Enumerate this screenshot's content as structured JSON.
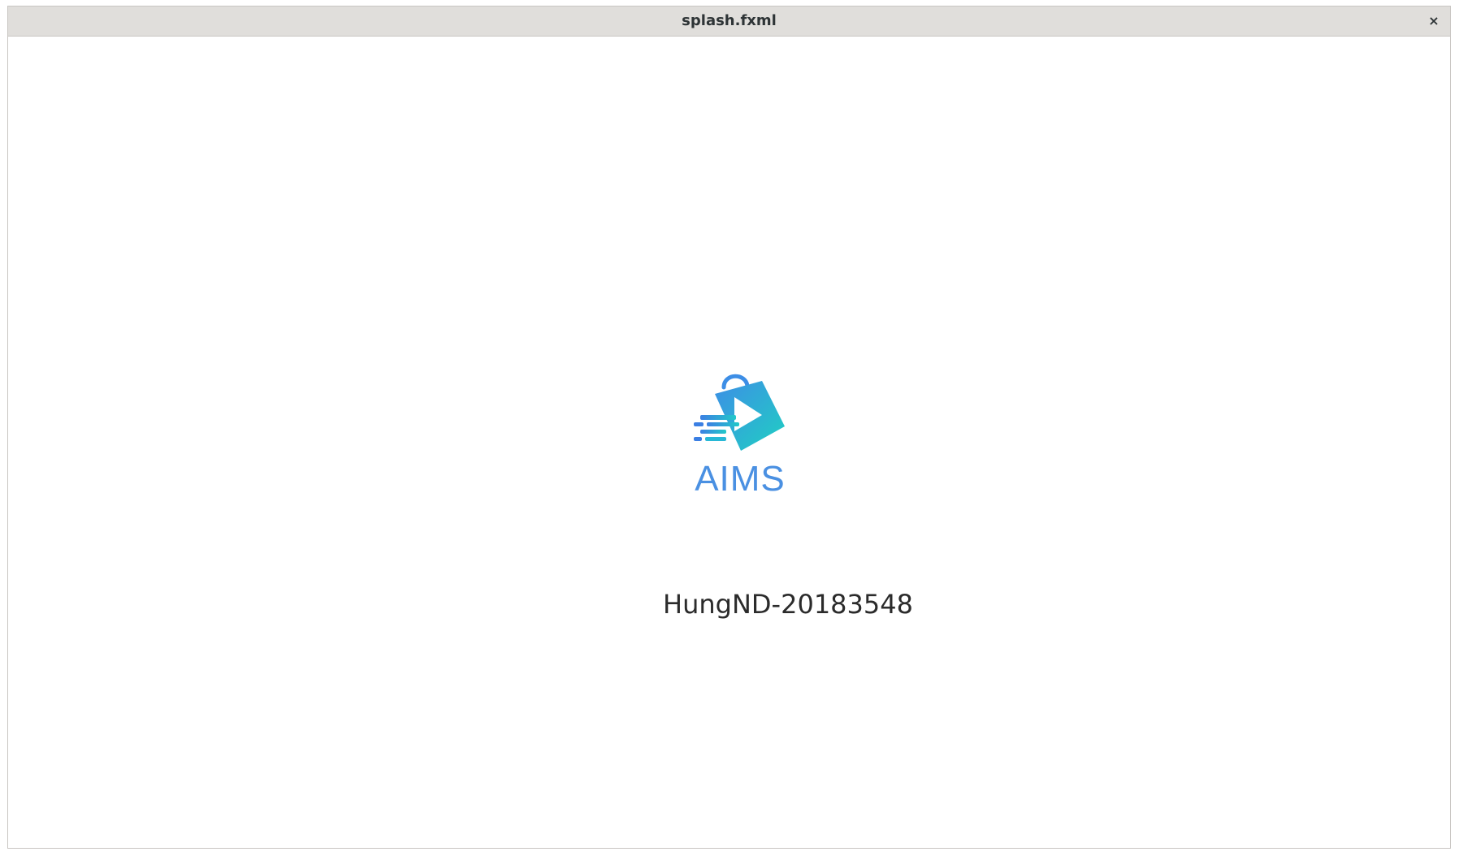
{
  "window": {
    "title": "splash.fxml",
    "close_symbol": "×"
  },
  "logo": {
    "text": "AIMS",
    "icon": "shopping-bag-arrow-icon",
    "colors": {
      "primary_blue": "#4a90e2",
      "teal": "#1ec9c9"
    }
  },
  "caption": {
    "text": "HungND-20183548"
  }
}
